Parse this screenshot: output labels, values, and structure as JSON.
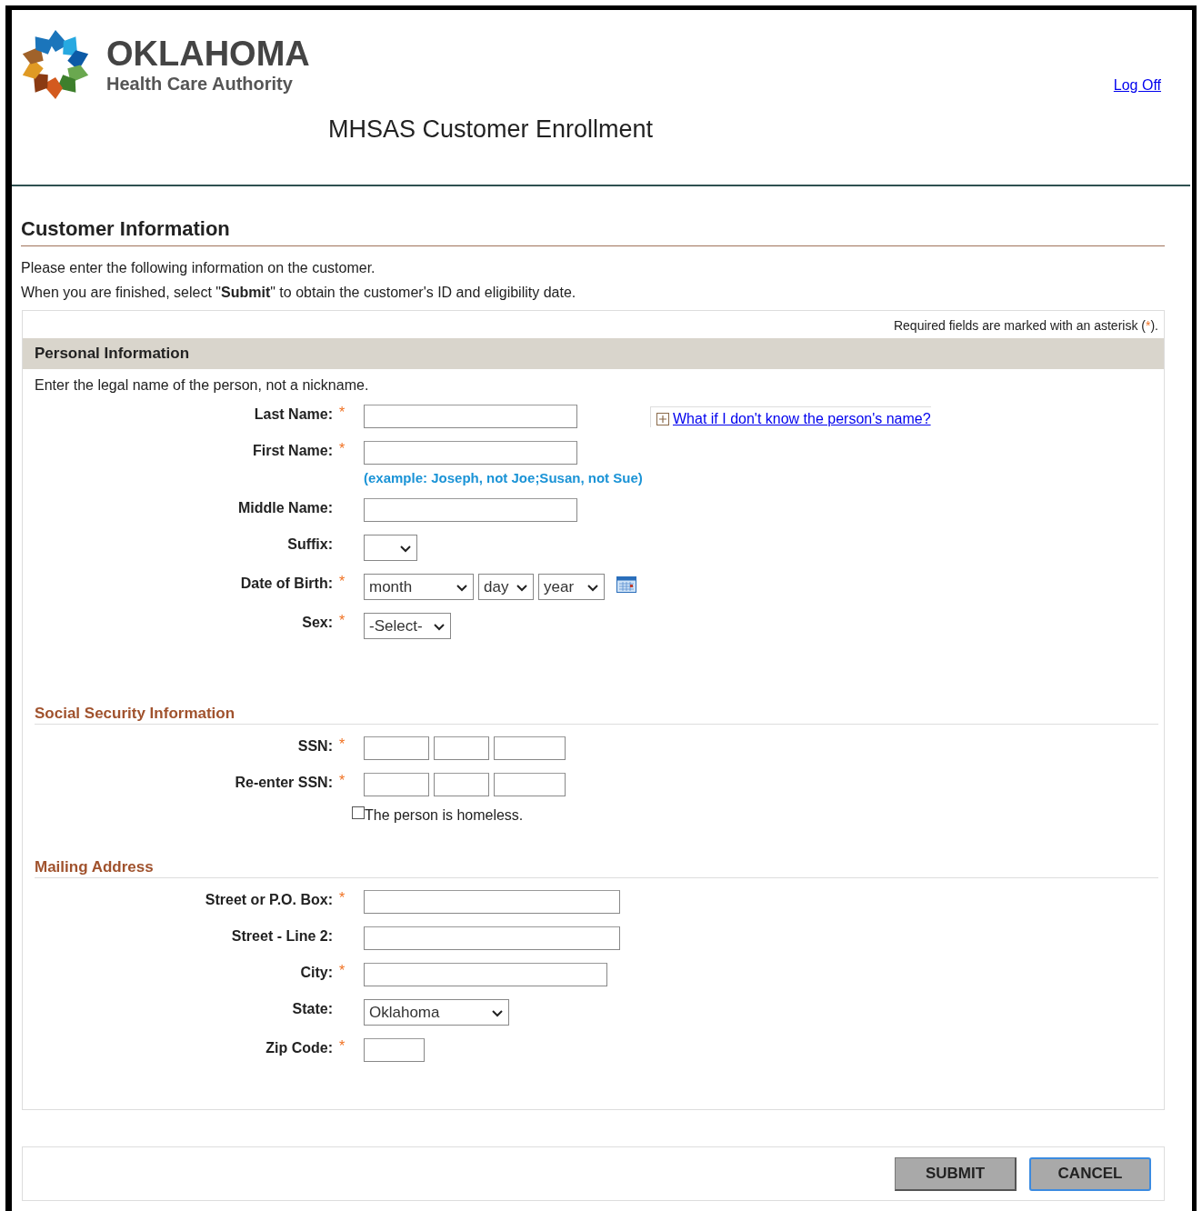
{
  "header": {
    "logo": {
      "title": "OKLAHOMA",
      "subtitle": "Health Care Authority"
    },
    "log_off": "Log Off",
    "page_title": "MHSAS Customer Enrollment"
  },
  "section": {
    "title": "Customer Information",
    "intro": [
      "Please enter the following information on the customer.",
      "When you are finished, select \"**Submit**\" to obtain the customer's ID and eligibility date."
    ]
  },
  "required_note": {
    "before": "Required fields are marked with an asterisk (",
    "mark": "*",
    "after": ")."
  },
  "groups": [
    {
      "kind": "bar",
      "title": "Personal Information",
      "intro": "Enter the legal name of the person, not a nickname.",
      "fields": [
        {
          "kind": "text",
          "label": "Last Name:",
          "required_mark": "*",
          "link": "What if I don't know the person's name?"
        },
        {
          "kind": "text",
          "label": "First Name:",
          "required_mark": "*",
          "hint": "(example: Joseph, not Joe;Susan, not Sue)"
        },
        {
          "kind": "text",
          "label": "Middle Name:"
        },
        {
          "kind": "suffix",
          "label": "Suffix:"
        },
        {
          "kind": "date",
          "label": "Date of Birth:",
          "required_mark": "*",
          "parts": [
            "month",
            "day",
            "year"
          ]
        },
        {
          "kind": "sex",
          "label": "Sex:",
          "required_mark": "*",
          "value": "-Select-"
        }
      ]
    },
    {
      "kind": "heading",
      "title": "Social Security Information",
      "fields": [
        {
          "kind": "ssn",
          "label": "SSN:",
          "required_mark": "*"
        },
        {
          "kind": "ssn",
          "label": "Re-enter SSN:",
          "required_mark": "*"
        },
        {
          "kind": "checkbox",
          "label": "The person is homeless.",
          "checked": false
        }
      ]
    },
    {
      "kind": "heading",
      "title": "Mailing Address",
      "fields": [
        {
          "kind": "address",
          "label": "Street or P.O. Box:",
          "required_mark": "*"
        },
        {
          "kind": "address",
          "label": "Street - Line 2:"
        },
        {
          "kind": "city",
          "label": "City:",
          "required_mark": "*"
        },
        {
          "kind": "state",
          "label": "State:",
          "value": "Oklahoma"
        },
        {
          "kind": "zip",
          "label": "Zip Code:",
          "required_mark": "*"
        }
      ]
    }
  ],
  "buttons": [
    {
      "label": "SUBMIT",
      "focused": false
    },
    {
      "label": "CANCEL",
      "focused": true
    }
  ]
}
